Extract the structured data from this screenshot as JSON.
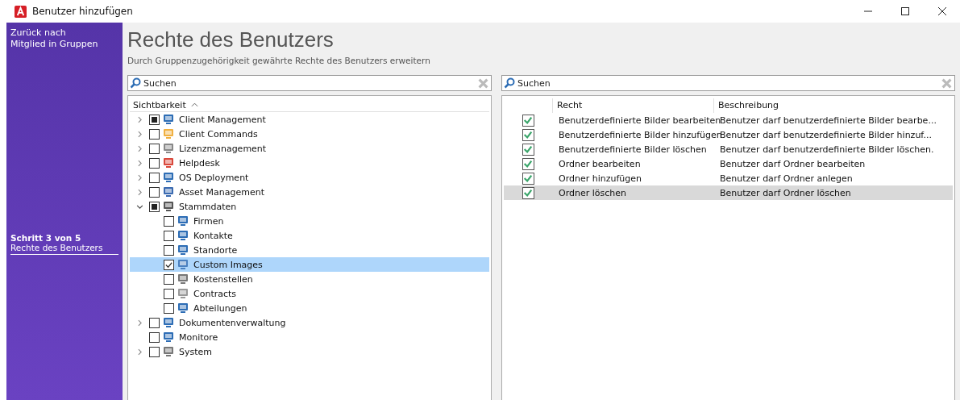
{
  "window": {
    "title": "Benutzer hinzufügen"
  },
  "sidebar": {
    "back_link": [
      "Zurück nach",
      "Mitglied in Gruppen"
    ],
    "step": "Schritt 3 von 5",
    "step_title": "Rechte des Benutzers"
  },
  "header": {
    "title": "Rechte des Benutzers",
    "subtitle": "Durch Gruppenzugehörigkeit gewährte Rechte des Benutzers erweitern"
  },
  "left_panel": {
    "search": {
      "placeholder": "Suchen"
    },
    "column": "Sichtbarkeit",
    "tree": [
      {
        "label": "Client Management",
        "checked": false,
        "partial": true,
        "expanded": false,
        "selected": false
      },
      {
        "label": "Client Commands",
        "checked": false,
        "partial": false,
        "expanded": false,
        "selected": false
      },
      {
        "label": "Lizenzmanagement",
        "checked": false,
        "partial": false,
        "expanded": false,
        "selected": false
      },
      {
        "label": "Helpdesk",
        "checked": false,
        "partial": false,
        "expanded": false,
        "selected": false
      },
      {
        "label": "OS Deployment",
        "checked": false,
        "partial": false,
        "expanded": false,
        "selected": false
      },
      {
        "label": "Asset Management",
        "checked": false,
        "partial": false,
        "expanded": false,
        "selected": false
      },
      {
        "label": "Stammdaten",
        "checked": false,
        "partial": true,
        "expanded": true,
        "selected": false,
        "children": [
          {
            "label": "Firmen",
            "checked": false,
            "partial": false,
            "selected": false
          },
          {
            "label": "Kontakte",
            "checked": false,
            "partial": false,
            "selected": false
          },
          {
            "label": "Standorte",
            "checked": false,
            "partial": false,
            "selected": false
          },
          {
            "label": "Custom Images",
            "checked": true,
            "partial": false,
            "selected": true
          },
          {
            "label": "Kostenstellen",
            "checked": false,
            "partial": false,
            "selected": false
          },
          {
            "label": "Contracts",
            "checked": false,
            "partial": false,
            "selected": false
          },
          {
            "label": "Abteilungen",
            "checked": false,
            "partial": false,
            "selected": false
          }
        ]
      },
      {
        "label": "Dokumentenverwaltung",
        "checked": false,
        "partial": false,
        "expanded": false,
        "selected": false
      },
      {
        "label": "Monitore",
        "checked": false,
        "partial": false,
        "selected": false
      },
      {
        "label": "System",
        "checked": false,
        "partial": false,
        "expanded": false,
        "selected": false
      }
    ]
  },
  "right_panel": {
    "search": {
      "placeholder": "Suchen"
    },
    "columns": [
      "Recht",
      "Beschreibung"
    ],
    "rows": [
      {
        "right": "Benutzerdefinierte Bilder bearbeiten",
        "description": "Benutzer darf benutzerdefinierte Bilder bearbe...",
        "checked": true,
        "selected": false
      },
      {
        "right": "Benutzerdefinierte Bilder hinzufügen",
        "description": "Benutzer darf benutzerdefinierte Bilder hinzuf...",
        "checked": true,
        "selected": false
      },
      {
        "right": "Benutzerdefinierte Bilder löschen",
        "description": "Benutzer darf benutzerdefinierte Bilder löschen.",
        "checked": true,
        "selected": false
      },
      {
        "right": "Ordner bearbeiten",
        "description": "Benutzer darf Ordner bearbeiten",
        "checked": true,
        "selected": false
      },
      {
        "right": "Ordner hinzufügen",
        "description": "Benutzer darf Ordner anlegen",
        "checked": true,
        "selected": false
      },
      {
        "right": "Ordner löschen",
        "description": "Benutzer darf Ordner löschen",
        "checked": true,
        "selected": true
      }
    ]
  }
}
